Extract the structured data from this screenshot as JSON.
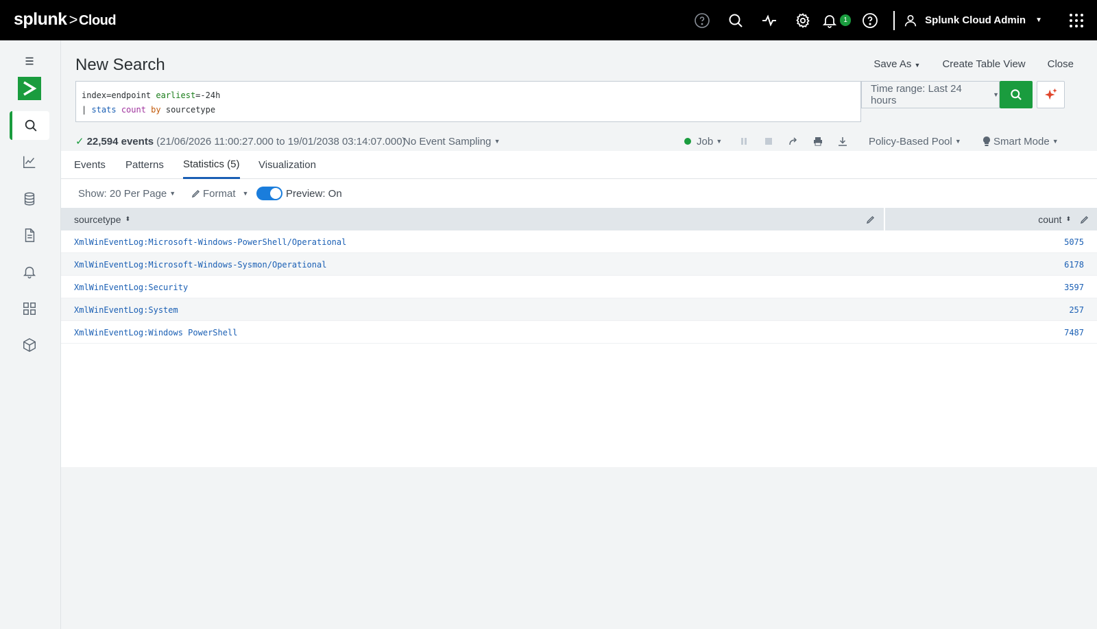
{
  "header": {
    "brand_name": "splunk",
    "brand_sep": ">",
    "brand_product": "Cloud",
    "notification_count": "1",
    "user_name": "Splunk Cloud Admin"
  },
  "search": {
    "title": "New Search",
    "actions": [
      "Save As",
      "Create Table View",
      "Close"
    ],
    "query_line1_a": "index=endpoint ",
    "query_line1_b": "earliest",
    "query_line1_c": "=-24h",
    "query_line2_a": "| ",
    "query_line2_b": "stats",
    "query_line2_c": "count",
    "query_line2_d": "by",
    "query_line2_e": "sourcetype",
    "time_range": "Time range: Last 24 hours"
  },
  "status": {
    "event_count": "22,594 events",
    "range": "(21/06/2026 11:00:27.000 to 19/01/2038 03:14:07.000)",
    "sampling": "No Event Sampling",
    "job": "Job",
    "pool": "Policy-Based Pool",
    "mode": "Smart Mode"
  },
  "tabs": [
    "Events",
    "Patterns",
    "Statistics (5)",
    "Visualization"
  ],
  "toolbar": {
    "per_page": "Show: 20 Per Page",
    "format": "Format",
    "preview": "Preview: On"
  },
  "table": {
    "columns": [
      "sourcetype",
      "count"
    ],
    "rows": [
      {
        "sourcetype": "XmlWinEventLog:Microsoft-Windows-PowerShell/Operational",
        "count": "5075"
      },
      {
        "sourcetype": "XmlWinEventLog:Microsoft-Windows-Sysmon/Operational",
        "count": "6178"
      },
      {
        "sourcetype": "XmlWinEventLog:Security",
        "count": "3597"
      },
      {
        "sourcetype": "XmlWinEventLog:System",
        "count": "257"
      },
      {
        "sourcetype": "XmlWinEventLog:Windows PowerShell",
        "count": "7487"
      }
    ]
  },
  "colors": {
    "accent_green": "#1a9c3e",
    "link_blue": "#1a5fb4"
  }
}
